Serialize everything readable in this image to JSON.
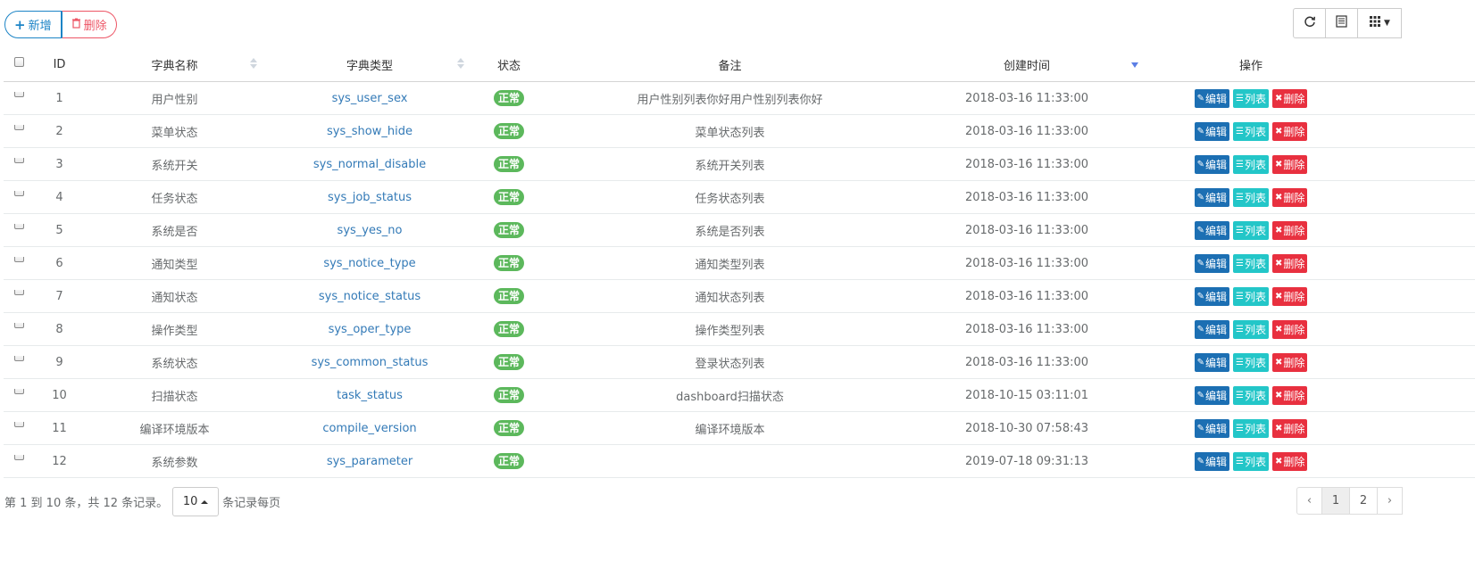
{
  "toolbar": {
    "add_label": "新增",
    "delete_label": "删除"
  },
  "right_tools": {
    "refresh_icon": "refresh-icon",
    "toggle_icon": "list-view-icon",
    "columns_icon": "grid-columns-icon"
  },
  "table": {
    "headers": {
      "id": "ID",
      "name": "字典名称",
      "type": "字典类型",
      "status": "状态",
      "remark": "备注",
      "created": "创建时间",
      "ops": "操作"
    },
    "rows": [
      {
        "id": "1",
        "name": "用户性别",
        "type": "sys_user_sex",
        "status": "正常",
        "remark": "用户性别列表你好用户性别列表你好",
        "created": "2018-03-16 11:33:00"
      },
      {
        "id": "2",
        "name": "菜单状态",
        "type": "sys_show_hide",
        "status": "正常",
        "remark": "菜单状态列表",
        "created": "2018-03-16 11:33:00"
      },
      {
        "id": "3",
        "name": "系统开关",
        "type": "sys_normal_disable",
        "status": "正常",
        "remark": "系统开关列表",
        "created": "2018-03-16 11:33:00"
      },
      {
        "id": "4",
        "name": "任务状态",
        "type": "sys_job_status",
        "status": "正常",
        "remark": "任务状态列表",
        "created": "2018-03-16 11:33:00"
      },
      {
        "id": "5",
        "name": "系统是否",
        "type": "sys_yes_no",
        "status": "正常",
        "remark": "系统是否列表",
        "created": "2018-03-16 11:33:00"
      },
      {
        "id": "6",
        "name": "通知类型",
        "type": "sys_notice_type",
        "status": "正常",
        "remark": "通知类型列表",
        "created": "2018-03-16 11:33:00"
      },
      {
        "id": "7",
        "name": "通知状态",
        "type": "sys_notice_status",
        "status": "正常",
        "remark": "通知状态列表",
        "created": "2018-03-16 11:33:00"
      },
      {
        "id": "8",
        "name": "操作类型",
        "type": "sys_oper_type",
        "status": "正常",
        "remark": "操作类型列表",
        "created": "2018-03-16 11:33:00"
      },
      {
        "id": "9",
        "name": "系统状态",
        "type": "sys_common_status",
        "status": "正常",
        "remark": "登录状态列表",
        "created": "2018-03-16 11:33:00"
      },
      {
        "id": "10",
        "name": "扫描状态",
        "type": "task_status",
        "status": "正常",
        "remark": "dashboard扫描状态",
        "created": "2018-10-15 03:11:01"
      },
      {
        "id": "11",
        "name": "编译环境版本",
        "type": "compile_version",
        "status": "正常",
        "remark": "编译环境版本",
        "created": "2018-10-30 07:58:43"
      },
      {
        "id": "12",
        "name": "系统参数",
        "type": "sys_parameter",
        "status": "正常",
        "remark": "",
        "created": "2019-07-18 09:31:13"
      }
    ],
    "row_actions": {
      "edit_label": "编辑",
      "list_label": "列表",
      "delete_label": "删除"
    }
  },
  "footer": {
    "summary": "第 1 到 10 条，共 12 条记录。",
    "page_size": "10",
    "per_page_label": "条记录每页"
  },
  "pager": {
    "prev": "‹",
    "pages": [
      "1",
      "2"
    ],
    "active_page": "1",
    "next": "›"
  },
  "colors": {
    "primary": "#1c84c6",
    "danger": "#ed5565",
    "success_badge": "#5cb85c",
    "edit_button": "#1c6fb3",
    "list_button": "#23c6c8",
    "delete_button": "#e8303f",
    "link": "#337ab7"
  }
}
